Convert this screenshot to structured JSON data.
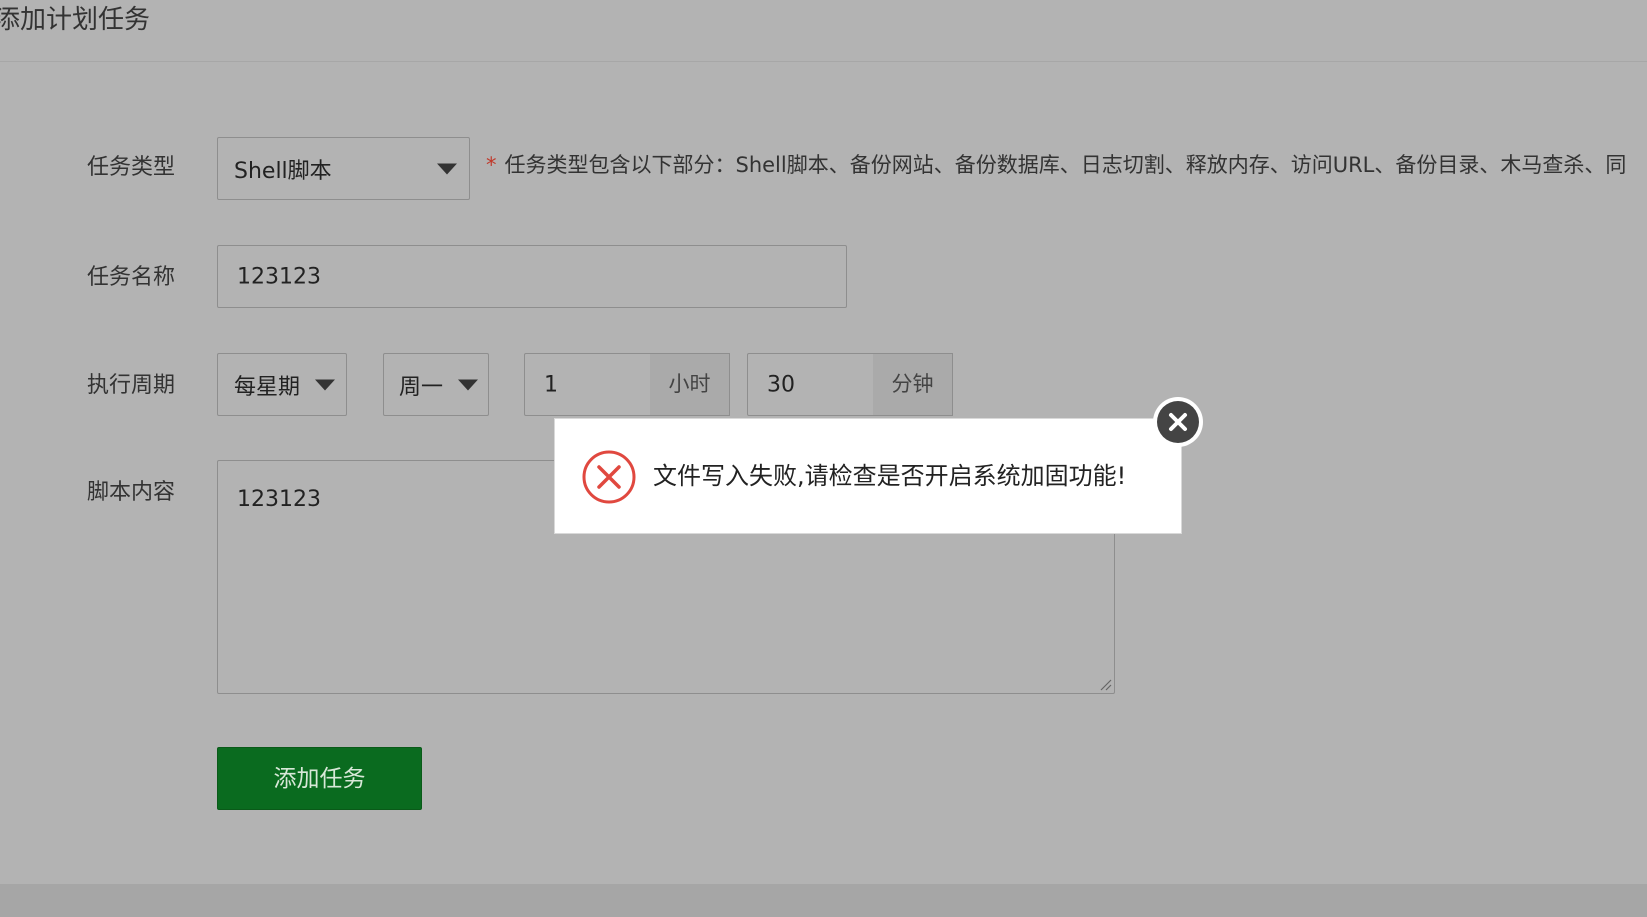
{
  "page": {
    "title": "添加计划任务"
  },
  "form": {
    "task_type": {
      "label": "任务类型",
      "value": "Shell脚本",
      "hint_star": "*",
      "hint": "任务类型包含以下部分：Shell脚本、备份网站、备份数据库、日志切割、释放内存、访问URL、备份目录、木马查杀、同"
    },
    "task_name": {
      "label": "任务名称",
      "value": "123123"
    },
    "period": {
      "label": "执行周期",
      "cycle": "每星期",
      "weekday": "周一",
      "hour": "1",
      "hour_unit": "小时",
      "minute": "30",
      "minute_unit": "分钟"
    },
    "script": {
      "label": "脚本内容",
      "value": "123123"
    },
    "submit_label": "添加任务"
  },
  "dialog": {
    "message": "文件写入失败,请检查是否开启系统加固功能!",
    "icon": "error-x-circle-icon",
    "close_icon": "close-icon",
    "accent": "#e0483f"
  }
}
